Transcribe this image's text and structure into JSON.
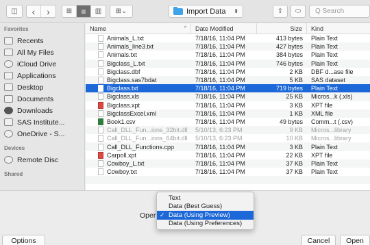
{
  "toolbar": {
    "sidebar_toggle_glyph": "◫",
    "back_glyph": "‹",
    "forward_glyph": "›",
    "view_icons_glyph": "⊞",
    "view_list_glyph": "≡",
    "view_columns_glyph": "▥",
    "arrange_glyph": "⊞⌄",
    "path_label": "Import Data",
    "path_arrow": "⬍",
    "share_glyph": "⇪",
    "tag_glyph": "⬭",
    "search_placeholder": "Q Search"
  },
  "sidebar": {
    "favorites_heading": "Favorites",
    "favorites": [
      "Recents",
      "All My Files",
      "iCloud Drive",
      "Applications",
      "Desktop",
      "Documents",
      "Downloads",
      "SAS Institute...",
      "OneDrive - S..."
    ],
    "devices_heading": "Devices",
    "devices": [
      "Remote Disc"
    ],
    "shared_heading": "Shared"
  },
  "columns": {
    "name": "Name",
    "sort_glyph": "^",
    "date": "Date Modified",
    "size": "Size",
    "kind": "Kind"
  },
  "files": [
    {
      "name": "Animals_L.txt",
      "date": "7/18/16, 11:04 PM",
      "size": "413 bytes",
      "kind": "Plain Text"
    },
    {
      "name": "Animals_line3.txt",
      "date": "7/18/16, 11:04 PM",
      "size": "427 bytes",
      "kind": "Plain Text"
    },
    {
      "name": "Animals.txt",
      "date": "7/18/16, 11:04 PM",
      "size": "384 bytes",
      "kind": "Plain Text"
    },
    {
      "name": "Bigclass_L.txt",
      "date": "7/18/16, 11:04 PM",
      "size": "746 bytes",
      "kind": "Plain Text"
    },
    {
      "name": "Bigclass.dbf",
      "date": "7/18/16, 11:04 PM",
      "size": "2 KB",
      "kind": "DBF d...ase file"
    },
    {
      "name": "Bigclass.sas7bdat",
      "date": "7/18/16, 11:04 PM",
      "size": "5 KB",
      "kind": "SAS dataset"
    },
    {
      "name": "Bigclass.txt",
      "date": "7/18/16, 11:04 PM",
      "size": "719 bytes",
      "kind": "Plain Text"
    },
    {
      "name": "Bigclass.xls",
      "date": "7/18/16, 11:04 PM",
      "size": "25 KB",
      "kind": "Micros...k (.xls)"
    },
    {
      "name": "Bigclass.xpt",
      "date": "7/18/16, 11:04 PM",
      "size": "3 KB",
      "kind": "XPT file"
    },
    {
      "name": "BigclassExcel.xml",
      "date": "7/18/16, 11:04 PM",
      "size": "1 KB",
      "kind": "XML file"
    },
    {
      "name": "Book1.csv",
      "date": "7/18/16, 11:04 PM",
      "size": "49 bytes",
      "kind": "Comm...t (.csv)"
    },
    {
      "name": "Call_DLL_Fun...ions_32bit.dll",
      "date": "5/10/13, 6:23 PM",
      "size": "9 KB",
      "kind": "Micros...library"
    },
    {
      "name": "Call_DLL_Fun...ions_64bit.dll",
      "date": "5/10/13, 6:23 PM",
      "size": "10 KB",
      "kind": "Micros...library"
    },
    {
      "name": "Call_DLL_Functions.cpp",
      "date": "7/18/16, 11:04 PM",
      "size": "3 KB",
      "kind": "Plain Text"
    },
    {
      "name": "Carpoll.xpt",
      "date": "7/18/16, 11:04 PM",
      "size": "22 KB",
      "kind": "XPT file"
    },
    {
      "name": "Cowboy_L.txt",
      "date": "7/18/16, 11:04 PM",
      "size": "37 KB",
      "kind": "Plain Text"
    },
    {
      "name": "Cowboy.txt",
      "date": "7/18/16, 11:04 PM",
      "size": "37 KB",
      "kind": "Plain Text"
    },
    {
      "name": "",
      "date": "",
      "size": "",
      "kind": ""
    }
  ],
  "selected_index": 6,
  "dimmed_indices": [
    11,
    12
  ],
  "open_as": {
    "label": "Open As",
    "options": [
      "Text",
      "Data (Best Guess)",
      "Data (Using Preview)",
      "Data (Using Preferences)"
    ],
    "selected_index": 2,
    "check_glyph": "✓"
  },
  "buttons": {
    "options": "Options",
    "cancel": "Cancel",
    "open": "Open"
  },
  "colors": {
    "selection": "#1d68d8",
    "folder": "#3fa3e8"
  }
}
